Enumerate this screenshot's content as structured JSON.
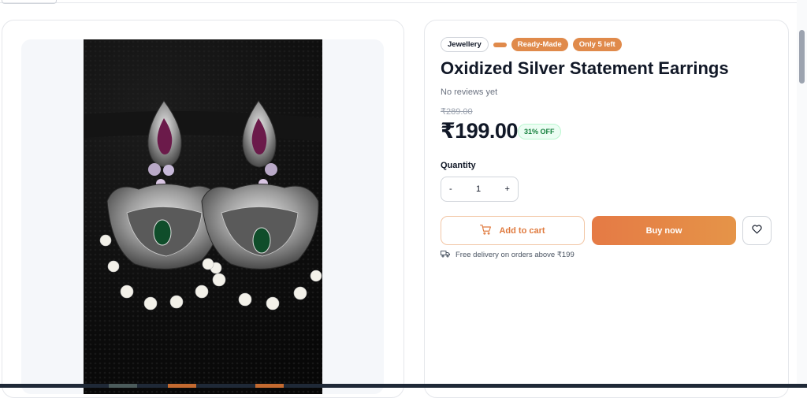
{
  "product": {
    "badges": {
      "category": "Jewellery",
      "type": "Ready-Made",
      "stock": "Only 5 left"
    },
    "title": "Oxidized Silver Statement Earrings",
    "reviews": "No reviews yet",
    "original_price": "₹289.00",
    "price": "₹199.00",
    "discount": "31% OFF"
  },
  "quantity": {
    "label": "Quantity",
    "decrement": "-",
    "value": "1",
    "increment": "+"
  },
  "actions": {
    "add_to_cart": "Add to cart",
    "buy_now": "Buy now"
  },
  "delivery": {
    "text": "Free delivery on orders above ₹199"
  },
  "colors": {
    "accent": "#e08a4b",
    "discount_green": "#15803d"
  },
  "icons": {
    "cart": "cart-icon",
    "heart": "heart-icon",
    "truck": "truck-icon"
  }
}
